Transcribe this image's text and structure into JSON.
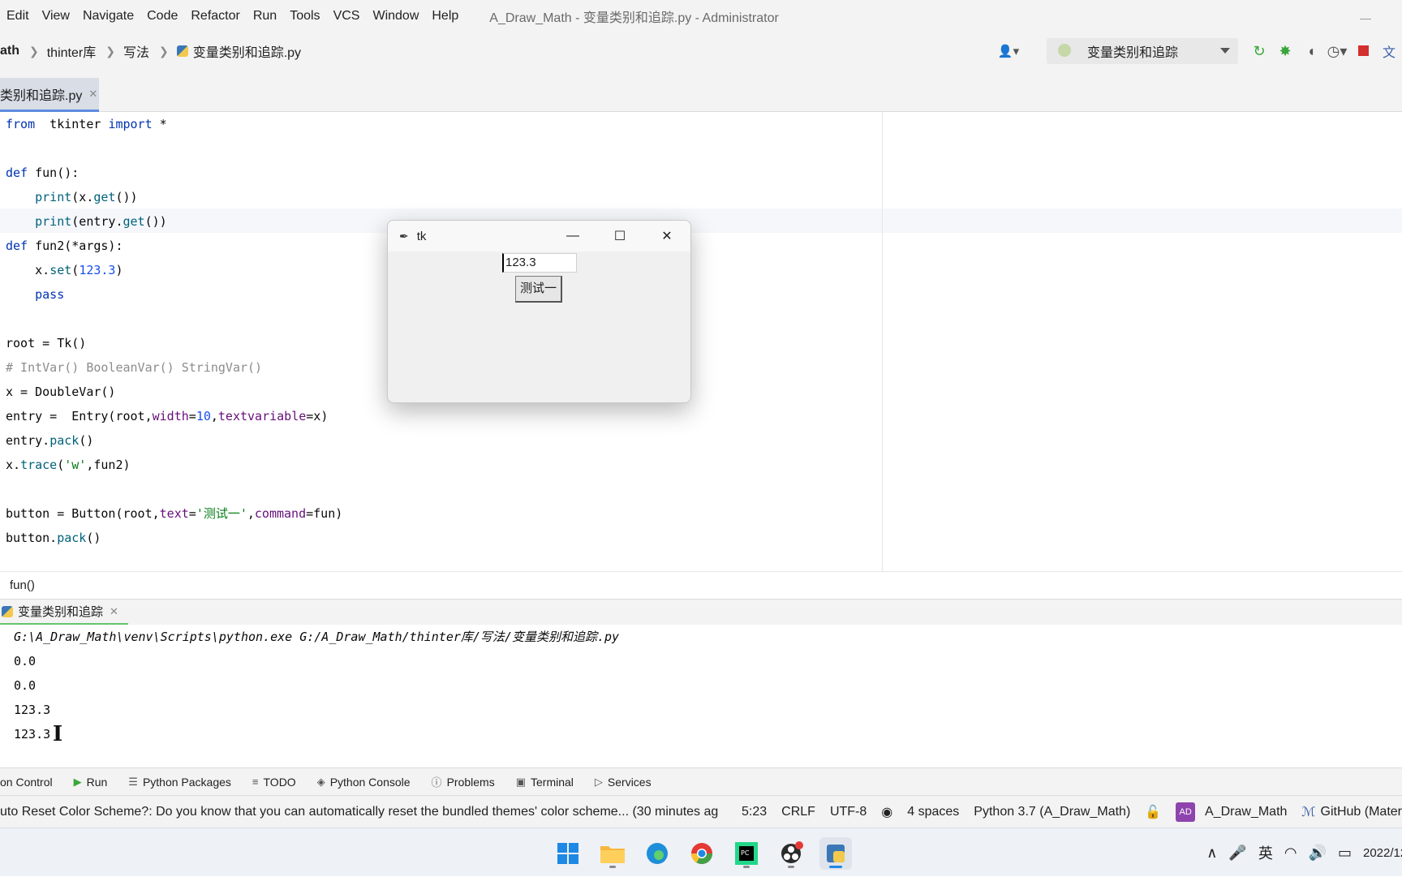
{
  "menubar": {
    "items": [
      "Edit",
      "View",
      "Navigate",
      "Code",
      "Refactor",
      "Run",
      "Tools",
      "VCS",
      "Window",
      "Help"
    ],
    "window_title": "A_Draw_Math - 变量类别和追踪.py - Administrator"
  },
  "navbar": {
    "crumbs": [
      "ath",
      "thinter库",
      "写法",
      "变量类别和追踪.py"
    ],
    "run_config": "变量类别和追踪"
  },
  "editor_tab": {
    "label": "类别和追踪.py"
  },
  "code": [
    "from  tkinter import *",
    "",
    "def fun():",
    "    print(x.get())",
    "    print(entry.get())",
    "def fun2(*args):",
    "    x.set(123.3)",
    "    pass",
    "",
    "root = Tk()",
    "# IntVar() BooleanVar() StringVar()",
    "x = DoubleVar()",
    "entry =  Entry(root,width=10,textvariable=x)",
    "entry.pack()",
    "x.trace('w',fun2)",
    "",
    "button = Button(root,text='测试一',command=fun)",
    "button.pack()"
  ],
  "editor_breadcrumb": "fun()",
  "run_panel": {
    "tab_label": "变量类别和追踪",
    "command": "G:\\A_Draw_Math\\venv\\Scripts\\python.exe G:/A_Draw_Math/thinter库/写法/变量类别和追踪.py",
    "output": [
      "0.0",
      "0.0",
      "123.3",
      "123.3"
    ]
  },
  "tool_windows": [
    "on Control",
    "Run",
    "Python Packages",
    "TODO",
    "Python Console",
    "Problems",
    "Terminal",
    "Services"
  ],
  "statusbar": {
    "message": "uto Reset Color Scheme?: Do you know that you can automatically reset the bundled themes' color scheme... (30 minutes ag",
    "position": "5:23",
    "line_sep": "CRLF",
    "encoding": "UTF-8",
    "indent": "4 spaces",
    "interpreter": "Python 3.7 (A_Draw_Math)",
    "badge": "AD",
    "project": "A_Draw_Math",
    "theme": "GitHub (Mater"
  },
  "tk_window": {
    "title": "tk",
    "entry_value": "123.3",
    "button_label": "测试一"
  },
  "taskbar": {
    "ime": "英",
    "clock": "2022/12"
  },
  "colors": {
    "keyword": "#0033b3",
    "number": "#1750eb",
    "string": "#067d17",
    "comment": "#8c8c8c",
    "run_tab_underline": "#67c36b",
    "stop": "#d32f2f",
    "run": "#3aa53a"
  }
}
